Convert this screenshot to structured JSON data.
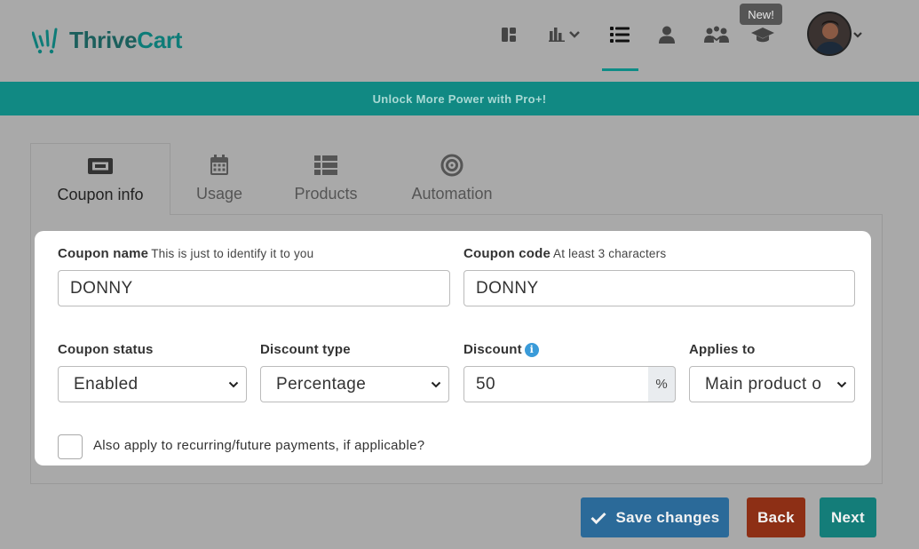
{
  "brand": {
    "name_part1": "Thrive",
    "name_part2": "Cart"
  },
  "nav": {
    "icons": [
      "dashboard-icon",
      "analytics-icon",
      "list-icon",
      "user-icon",
      "affiliates-icon",
      "graduation-cap-icon"
    ],
    "new_badge": "New!"
  },
  "promo": {
    "text": "Unlock More Power with Pro+!"
  },
  "tabs": [
    {
      "label": "Coupon info",
      "icon": "ticket-icon",
      "active": true
    },
    {
      "label": "Usage",
      "icon": "calendar-icon",
      "active": false
    },
    {
      "label": "Products",
      "icon": "list-icon",
      "active": false
    },
    {
      "label": "Automation",
      "icon": "target-icon",
      "active": false
    }
  ],
  "form": {
    "coupon_name": {
      "label": "Coupon name",
      "hint": "This is just to identify it to you",
      "value": "DONNY"
    },
    "coupon_code": {
      "label": "Coupon code",
      "hint": "At least 3 characters",
      "value": "DONNY"
    },
    "coupon_status": {
      "label": "Coupon status",
      "value": "Enabled"
    },
    "discount_type": {
      "label": "Discount type",
      "value": "Percentage"
    },
    "discount": {
      "label": "Discount",
      "value": "50",
      "suffix": "%"
    },
    "applies_to": {
      "label": "Applies to",
      "value": "Main product o"
    },
    "recurring": {
      "label": "Also apply to recurring/future payments, if applicable?",
      "checked": false
    }
  },
  "buttons": {
    "save": "Save changes",
    "back": "Back",
    "next": "Next"
  },
  "colors": {
    "accent": "#118983",
    "save": "#2b6a99",
    "back": "#8d2f15",
    "next": "#147d79"
  }
}
